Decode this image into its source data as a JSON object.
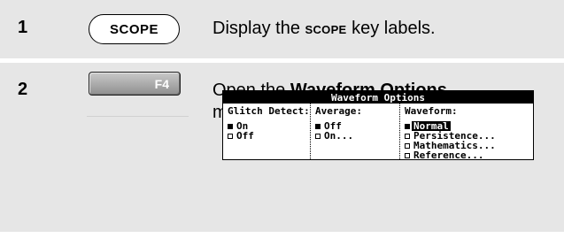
{
  "steps": [
    {
      "number": "1",
      "key_label": "SCOPE",
      "instruction": {
        "pre": "Display the ",
        "key": "SCOPE",
        "post": " key labels."
      }
    },
    {
      "number": "2",
      "key_label": "F4",
      "instruction": {
        "pre": "Open the ",
        "bold": "Waveform Options",
        "post": " menu."
      }
    }
  ],
  "menu": {
    "title": "Waveform Options",
    "columns": [
      {
        "header": "Glitch Detect:",
        "options": [
          {
            "label": "On",
            "checked": true,
            "highlighted": false
          },
          {
            "label": "Off",
            "checked": false,
            "highlighted": false
          }
        ]
      },
      {
        "header": "Average:",
        "options": [
          {
            "label": "Off",
            "checked": true,
            "highlighted": false
          },
          {
            "label": "On...",
            "checked": false,
            "highlighted": false
          }
        ]
      },
      {
        "header": "Waveform:",
        "options": [
          {
            "label": "Normal",
            "checked": true,
            "highlighted": true
          },
          {
            "label": "Persistence...",
            "checked": false,
            "highlighted": false
          },
          {
            "label": "Mathematics...",
            "checked": false,
            "highlighted": false
          },
          {
            "label": "Reference...",
            "checked": false,
            "highlighted": false
          }
        ]
      }
    ]
  }
}
